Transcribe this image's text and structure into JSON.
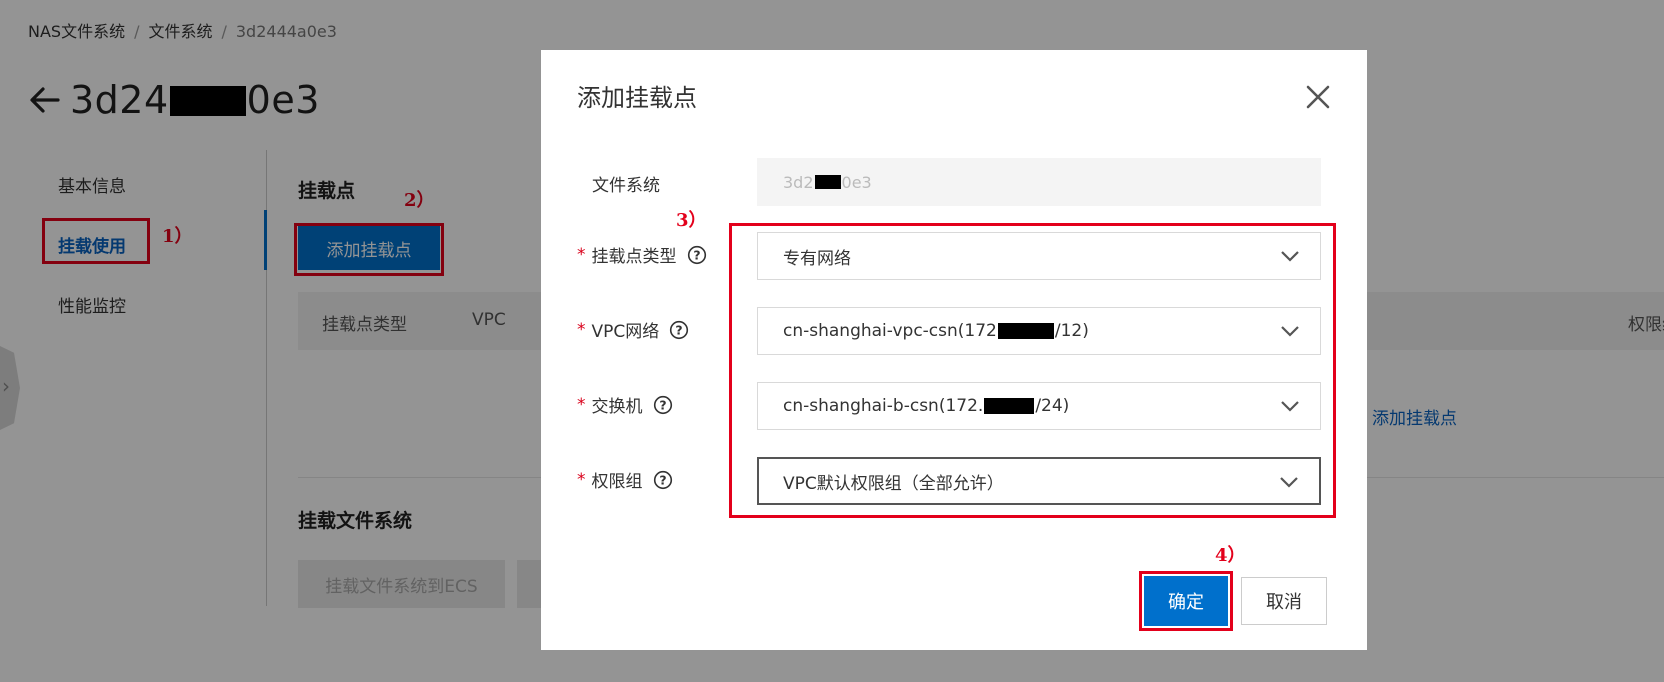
{
  "breadcrumb": {
    "root": "NAS文件系统",
    "mid": "文件系统",
    "current": "3d2444a0e3",
    "separator": "/"
  },
  "page": {
    "title_prefix": "3d24",
    "title_suffix": "0e3"
  },
  "side_nav": {
    "items": [
      "基本信息",
      "挂载使用",
      "性能监控"
    ],
    "active": "挂载使用"
  },
  "mount_section": {
    "title": "挂载点",
    "add_button": "添加挂载点",
    "columns": [
      "挂载点类型",
      "VPC",
      "权限组"
    ],
    "empty_link": "添加挂载点"
  },
  "mount_fs_section": {
    "title": "挂载文件系统",
    "button": "挂载文件系统到ECS"
  },
  "modal": {
    "title": "添加挂载点",
    "file_system": {
      "label": "文件系统",
      "value_prefix": "3d2",
      "value_suffix": "0e3"
    },
    "mount_type": {
      "label": "挂载点类型",
      "value": "专有网络"
    },
    "vpc": {
      "label": "VPC网络",
      "value_prefix": "cn-shanghai-vpc-csn(172",
      "value_suffix": "/12)"
    },
    "vswitch": {
      "label": "交换机",
      "value_prefix": "cn-shanghai-b-csn(172.",
      "value_suffix": "/24)"
    },
    "permission_group": {
      "label": "权限组",
      "value": "VPC默认权限组（全部允许）"
    },
    "confirm": "确定",
    "cancel": "取消"
  },
  "steps": [
    "1）",
    "2）",
    "3）",
    "4）"
  ],
  "colors": {
    "primary": "#0070cc",
    "link": "#0a63c2",
    "annotation": "#e3001b",
    "required": "#d9001b"
  }
}
